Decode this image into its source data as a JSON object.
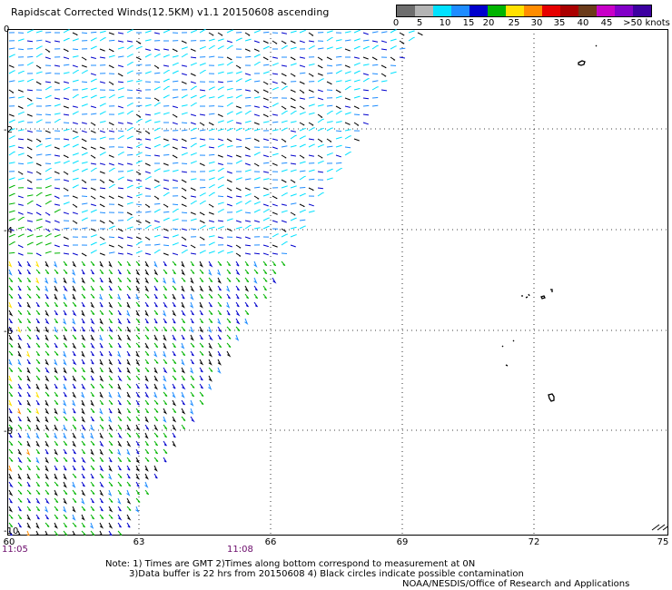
{
  "title": "Rapidscat Corrected Winds(12.5KM) v1.1 20150608 ascending",
  "legend": {
    "labels": [
      "0",
      "5",
      "10",
      "15",
      "20",
      "25",
      "30",
      "35",
      "40",
      "45",
      ">50 knots"
    ],
    "colors": [
      "#6e6e6e",
      "#b4b4b4",
      "#00e1ff",
      "#1e8cff",
      "#0000cd",
      "#00b400",
      "#ffe100",
      "#ff8c00",
      "#e60000",
      "#aa0000",
      "#6b3b1a",
      "#c800c8",
      "#8200c8",
      "#3c00a0"
    ]
  },
  "axes": {
    "x_ticks": [
      "60",
      "63",
      "66",
      "69",
      "72",
      "75"
    ],
    "y_ticks": [
      "0",
      "-2",
      "-4",
      "-6",
      "-8",
      "-10"
    ]
  },
  "times": [
    "11:05",
    "11:08"
  ],
  "notes": {
    "line1": "Note: 1) Times are GMT 2)Times along bottom correspond to measurement at 0N",
    "line2": "3)Data buffer is 22 hrs from 20150608 4) Black circles indicate possible contamination",
    "line3": "NOAA/NESDIS/Office of Research and Applications"
  }
}
